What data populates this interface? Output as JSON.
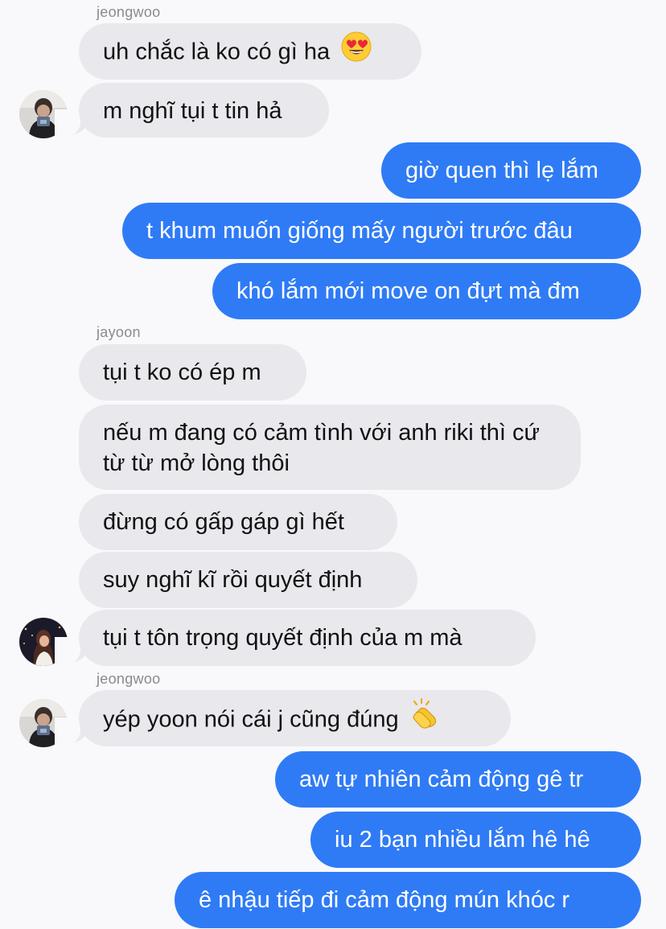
{
  "thread": {
    "sender_jeongwoo_1": "jeongwoo",
    "sender_jayoon": "jayoon",
    "sender_jeongwoo_2": "jeongwoo"
  },
  "messages": [
    {
      "from": "jeongwoo",
      "text": "uh chắc là ko có gì ha",
      "emoji": "heart-eyes-emoji"
    },
    {
      "from": "jeongwoo",
      "text": "m nghĩ tụi t tin hả"
    },
    {
      "from": "me",
      "text": "giờ quen thì lẹ lắm"
    },
    {
      "from": "me",
      "text": "t khum muốn giống mấy người trước đâu"
    },
    {
      "from": "me",
      "text": "khó lắm mới move on đựt mà đm"
    },
    {
      "from": "jayoon",
      "text": "tụi t ko có ép m"
    },
    {
      "from": "jayoon",
      "text": "nếu m đang có cảm tình với anh riki thì cứ từ từ mở lòng thôi"
    },
    {
      "from": "jayoon",
      "text": "đừng có gấp gáp gì hết"
    },
    {
      "from": "jayoon",
      "text": "suy nghĩ kĩ rồi quyết định"
    },
    {
      "from": "jayoon",
      "text": "tụi t tôn trọng quyết định của m mà"
    },
    {
      "from": "jeongwoo",
      "text": "yép yoon nói cái j cũng đúng",
      "emoji": "clapping-hands-emoji"
    },
    {
      "from": "me",
      "text": "aw tự nhiên cảm động gê tr"
    },
    {
      "from": "me",
      "text": "iu 2 bạn nhiều lắm hê hê"
    },
    {
      "from": "me",
      "text": "ê nhậu tiếp đi cảm động mún khóc r"
    }
  ],
  "colors": {
    "background": "#f9f9fb",
    "incoming_bubble": "#e8e8ed",
    "outgoing_bubble": "#2f7bf6",
    "sender_name": "#8a8a8f"
  }
}
